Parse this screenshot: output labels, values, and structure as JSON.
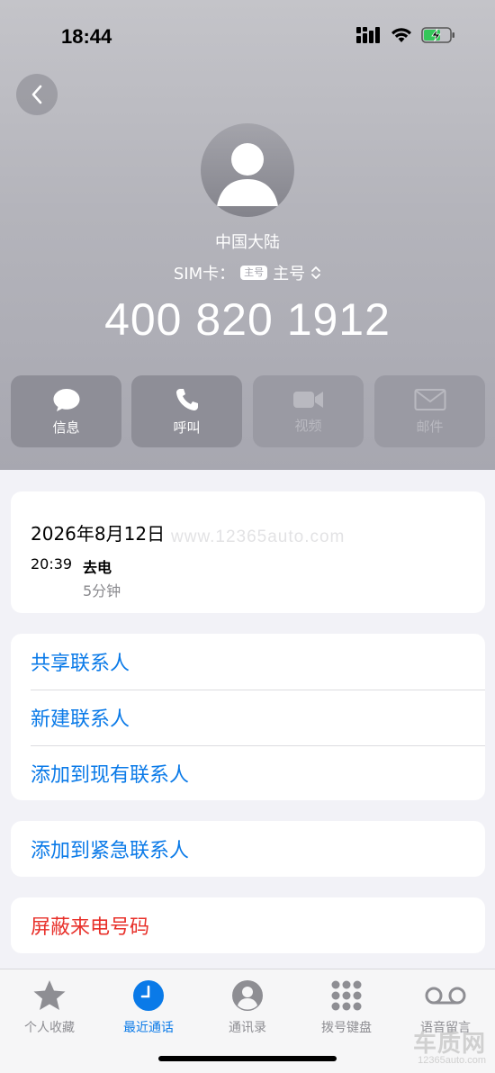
{
  "status_bar": {
    "time": "18:44"
  },
  "contact": {
    "region": "中国大陆",
    "sim_label": "SIM卡：",
    "sim_badge": "主号",
    "sim_value": "主号",
    "phone_number": "400 820 1912"
  },
  "actions": [
    {
      "label": "信息",
      "icon": "message-icon",
      "enabled": true
    },
    {
      "label": "呼叫",
      "icon": "phone-icon",
      "enabled": true
    },
    {
      "label": "视频",
      "icon": "video-icon",
      "enabled": false
    },
    {
      "label": "邮件",
      "icon": "mail-icon",
      "enabled": false
    }
  ],
  "call_log": {
    "date": "2026年8月12日",
    "time": "20:39",
    "type": "去电",
    "duration": "5分钟"
  },
  "watermark": "www.12365auto.com",
  "menu_group_1": [
    "共享联系人",
    "新建联系人",
    "添加到现有联系人"
  ],
  "menu_group_2": [
    "添加到紧急联系人"
  ],
  "menu_group_3": [
    "屏蔽来电号码"
  ],
  "colors": {
    "link_blue": "#0a7ae8",
    "danger_red": "#e8302a"
  },
  "tabs": [
    {
      "label": "个人收藏",
      "icon": "star-icon",
      "active": false
    },
    {
      "label": "最近通话",
      "icon": "clock-icon",
      "active": true
    },
    {
      "label": "通讯录",
      "icon": "contacts-icon",
      "active": false
    },
    {
      "label": "拨号键盘",
      "icon": "keypad-icon",
      "active": false
    },
    {
      "label": "语音留言",
      "icon": "voicemail-icon",
      "active": false
    }
  ],
  "brand": {
    "name": "车质网",
    "url": "12365auto.com"
  }
}
